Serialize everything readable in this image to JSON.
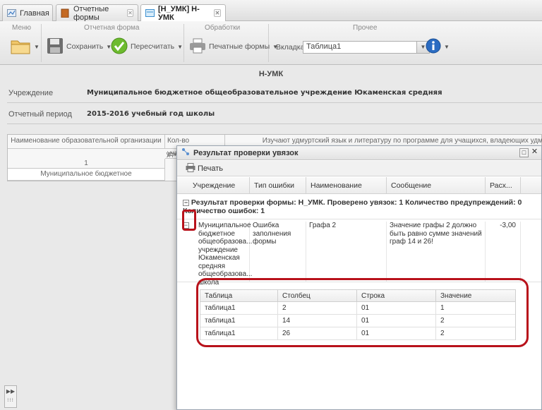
{
  "tabs": [
    {
      "label": "Главная",
      "icon": "home-icon",
      "closable": false
    },
    {
      "label": "Отчетные формы",
      "icon": "folder-icon",
      "closable": true
    },
    {
      "label": "[Н_УМК] Н-УМК",
      "icon": "form-icon",
      "closable": true,
      "active": true
    }
  ],
  "toolbar": {
    "groups": [
      "Меню",
      "Отчетная форма",
      "Обработки",
      "Прочее"
    ],
    "save_label": "Сохранить",
    "recalc_label": "Пересчитать",
    "print_forms_label": "Печатные формы",
    "tab_label": "Вкладка",
    "tab_value": "Таблица1"
  },
  "form": {
    "title": "Н-УМК",
    "institution_label": "Учреждение",
    "institution_value": "Муниципальное бюджетное общеобразовательное учреждение Юкаменская средняя",
    "period_label": "Отчетный период",
    "period_value": "2015-2016 учебный год школы"
  },
  "bg_table": {
    "col1_header": "Наименование образовательной организации",
    "col2_header": "Кол-во учащихся,",
    "col3_header": "Изучают удмуртский язык и литературу по программе для учащихся, владеющих удм",
    "col2_sub": "удм",
    "row_num": "1",
    "row_text": "Муниципальное бюджетное"
  },
  "dialog": {
    "title": "Результат проверки увязок",
    "print_label": "Печать",
    "columns": [
      "Учреждение",
      "Тип ошибки",
      "Наименование",
      "Сообщение",
      "Расх..."
    ],
    "summary": "Результат проверки формы: Н_УМК. Проверено увязок: 1 Количество предупреждений: 0 Количество ошибок: 1",
    "row": {
      "institution": "Муниципальное бюджетное общеобразова... учреждение Юкаменская средняя общеобразова... школа",
      "error_type": "Ошибка заполнения формы",
      "name": "Графа 2",
      "message": "Значение графы 2 должно быть равно сумме значений граф 14 и 26!",
      "diff": "-3,00"
    },
    "nested": {
      "columns": [
        "Таблица",
        "Столбец",
        "Строка",
        "Значение"
      ],
      "rows": [
        [
          "таблица1",
          "2",
          "01",
          "1"
        ],
        [
          "таблица1",
          "14",
          "01",
          "2"
        ],
        [
          "таблица1",
          "26",
          "01",
          "2"
        ]
      ]
    }
  },
  "colors": {
    "highlight_red": "#b8121b",
    "accent_blue": "#2b6cc2",
    "accent_green": "#6dbb2e"
  }
}
